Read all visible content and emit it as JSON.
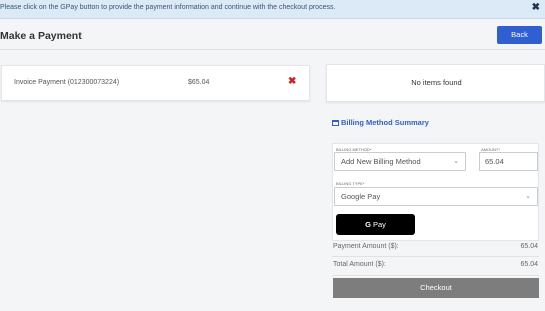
{
  "alert": {
    "message": "Please click on the GPay button to provide the payment information and continue with the checkout process.",
    "close_icon": "✖"
  },
  "header": {
    "title": "Make a Payment",
    "back_label": "Back"
  },
  "invoice": {
    "label": "Invoice Payment (012300073224)",
    "amount": "$65.04",
    "remove_icon": "✖"
  },
  "items_panel": {
    "empty_text": "No items found"
  },
  "billing_summary": {
    "title": "Billing Method Summary",
    "billing_method_label": "BILLING METHOD*",
    "billing_method_value": "Add New Billing Method",
    "amount_label": "AMOUNT*",
    "amount_value": "65.04",
    "billing_type_label": "BILLING TYPE*",
    "billing_type_value": "Google Pay",
    "gpay_g": "G",
    "gpay_text": "Pay"
  },
  "summary": {
    "payment_amount_label": "Payment Amount ($):",
    "payment_amount_value": "65.04",
    "total_amount_label": "Total Amount ($):",
    "total_amount_value": "65.04"
  },
  "checkout_label": "Checkout",
  "colors": {
    "accent": "#2f5fd0",
    "alert_bg": "#dce9f7",
    "danger": "#d62020",
    "checkout_bg": "#7d7d7d"
  }
}
